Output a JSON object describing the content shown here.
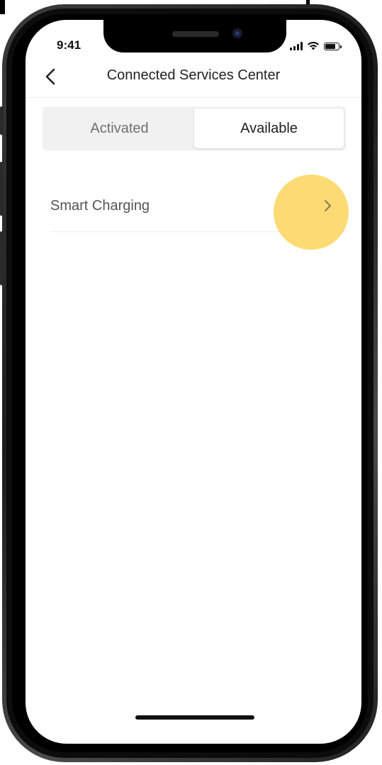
{
  "status_bar": {
    "time": "9:41",
    "signal_bars": 4,
    "battery_level": 0.85
  },
  "nav": {
    "title": "Connected Services Center",
    "back_icon": "chevron-left-icon"
  },
  "tabs": [
    {
      "label": "Activated",
      "selected": false
    },
    {
      "label": "Available",
      "selected": true
    }
  ],
  "services": [
    {
      "label": "Smart Charging",
      "icon": "chevron-right-icon"
    }
  ],
  "colors": {
    "highlight": "#fcd96e",
    "text_primary": "#222222",
    "text_secondary": "#707070",
    "segment_bg": "#f1f1f1"
  }
}
